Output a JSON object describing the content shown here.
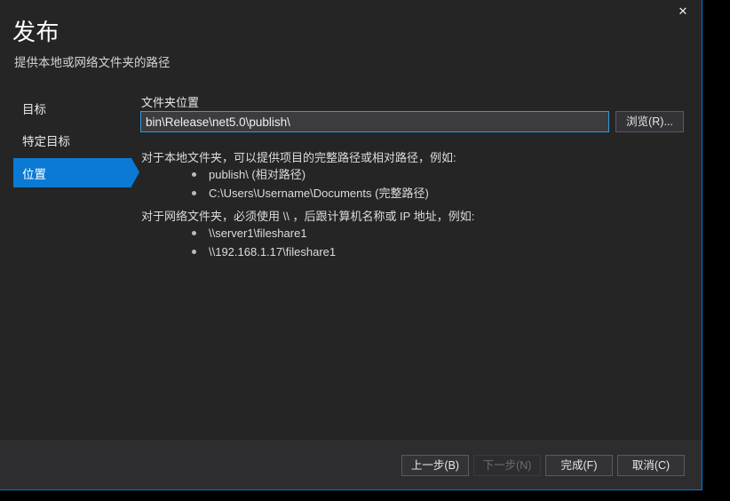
{
  "window": {
    "close_icon": "close-icon",
    "close_glyph": "✕"
  },
  "header": {
    "title": "发布",
    "subtitle": "提供本地或网络文件夹的路径"
  },
  "sidebar": {
    "items": [
      {
        "label": "目标",
        "selected": false
      },
      {
        "label": "特定目标",
        "selected": false
      },
      {
        "label": "位置",
        "selected": true
      }
    ]
  },
  "main": {
    "folder_label": "文件夹位置",
    "folder_value": "bin\\Release\\net5.0\\publish\\",
    "folder_placeholder": "",
    "browse_label": "浏览(R)...",
    "local_paragraph": "对于本地文件夹，可以提供项目的完整路径或相对路径，例如:",
    "local_examples": [
      "publish\\ (相对路径)",
      "C:\\Users\\Username\\Documents (完整路径)"
    ],
    "network_paragraph": "对于网络文件夹，必须使用 \\\\ ，后跟计算机名称或 IP 地址，例如:",
    "network_examples": [
      "\\\\server1\\fileshare1",
      "\\\\192.168.1.17\\fileshare1"
    ]
  },
  "footer": {
    "back_label": "上一步(B)",
    "next_label": "下一步(N)",
    "finish_label": "完成(F)",
    "cancel_label": "取消(C)"
  },
  "colors": {
    "accent": "#007acc",
    "selection": "#0b7ad4",
    "dialog_bg": "#252526",
    "footer_bg": "#2d2d30",
    "input_bg": "#3c3c3f",
    "button_bg": "#333337",
    "text": "#f1f1f1"
  }
}
